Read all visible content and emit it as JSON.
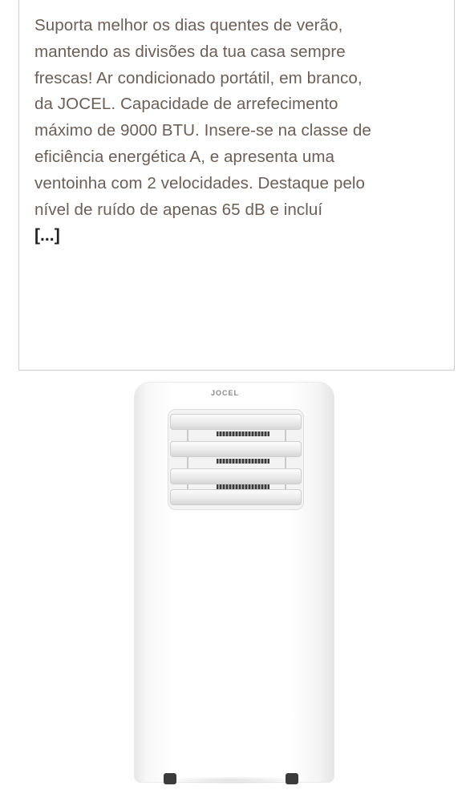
{
  "description": {
    "lines": [
      "Suporta melhor os dias quentes de verão,",
      "mantendo as divisões da tua casa sempre",
      "frescas! Ar condicionado portátil, em branco,",
      "da JOCEL. Capacidade de arrefecimento",
      "máximo de 9000 BTU. Insere-se na classe de",
      "eficiência energética A, e apresenta uma",
      "ventoinha com 2 velocidades. Destaque pelo",
      "nível de ruído de apenas 65 dB e incluí"
    ],
    "more_label": "[...]"
  },
  "product_image": {
    "brand_label": "JOCEL",
    "icon": "portable-air-conditioner"
  }
}
